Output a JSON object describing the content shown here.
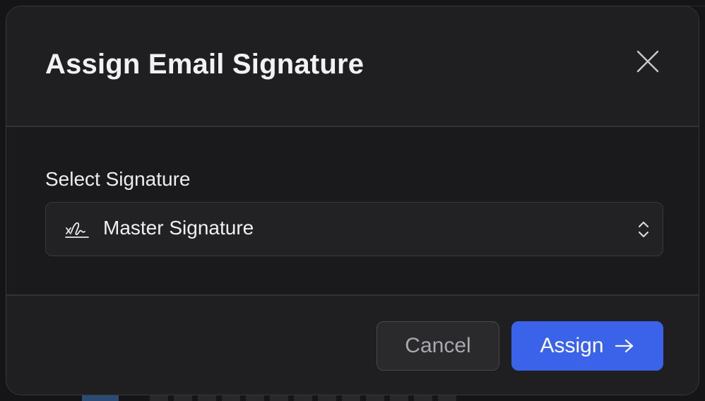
{
  "modal": {
    "title": "Assign Email Signature",
    "close_icon": "close-icon"
  },
  "field": {
    "label": "Select Signature",
    "selected_value": "Master Signature",
    "leading_icon": "signature-icon",
    "trailing_icon": "chevron-up-down-icon"
  },
  "footer": {
    "cancel_label": "Cancel",
    "assign_label": "Assign",
    "assign_icon": "arrow-right-icon"
  },
  "colors": {
    "primary": "#3a63ea",
    "surface": "#1c1c1e",
    "text": "#f2f2f3"
  }
}
